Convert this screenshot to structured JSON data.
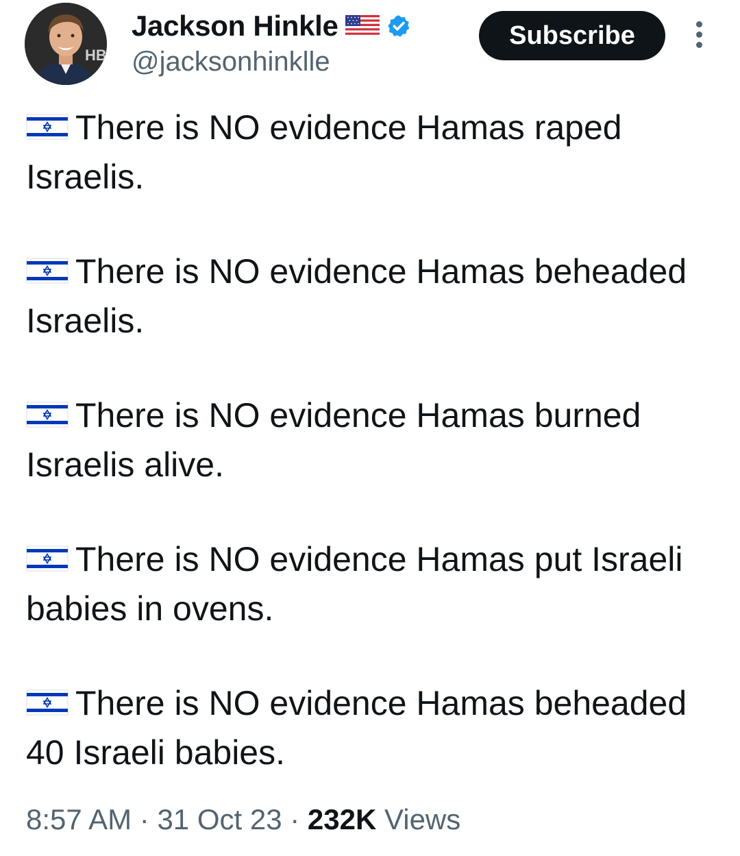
{
  "author": {
    "display_name": "Jackson Hinkle",
    "handle": "@jacksonhinklle",
    "verified": true,
    "name_emoji": "us-flag-icon",
    "avatar_backdrop_text": "HB"
  },
  "actions": {
    "subscribe_label": "Subscribe",
    "more_icon": "more-vertical-icon"
  },
  "tweet": {
    "paragraph_icon": "israel-flag-icon",
    "paragraphs": [
      {
        "text": "There is NO evidence Hamas raped Israelis."
      },
      {
        "text": "There is NO evidence Hamas beheaded Israelis."
      },
      {
        "text": "There is NO evidence Hamas burned Israelis alive."
      },
      {
        "text": "There is NO evidence Hamas put Israeli babies in ovens."
      },
      {
        "text": "There is NO evidence Hamas beheaded 40 Israeli babies."
      }
    ]
  },
  "meta": {
    "time": "8:57 AM",
    "separator": "·",
    "date": "31 Oct 23",
    "views_count": "232K",
    "views_label": "Views"
  },
  "colors": {
    "text_primary": "#0f1419",
    "text_secondary": "#536471",
    "verified_blue": "#1d9bf0",
    "button_bg": "#0f1419",
    "israel_blue": "#0038b8"
  }
}
